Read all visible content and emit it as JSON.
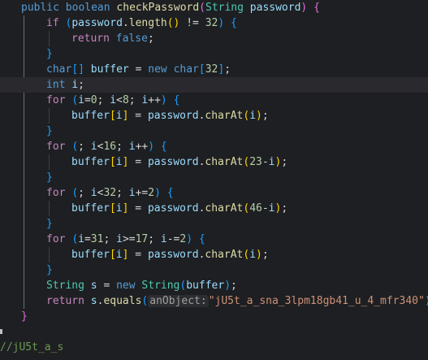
{
  "editor": {
    "lines": [
      [
        {
          "t": "public",
          "c": "kw"
        },
        {
          "t": " ",
          "c": "pun"
        },
        {
          "t": "boolean",
          "c": "kw"
        },
        {
          "t": " ",
          "c": "pun"
        },
        {
          "t": "checkPassword",
          "c": "fn"
        },
        {
          "t": "(",
          "c": "brace"
        },
        {
          "t": "String",
          "c": "type"
        },
        {
          "t": " ",
          "c": "pun"
        },
        {
          "t": "password",
          "c": "var"
        },
        {
          "t": ")",
          "c": "brace"
        },
        {
          "t": " ",
          "c": "pun"
        },
        {
          "t": "{",
          "c": "brace"
        }
      ],
      [
        {
          "t": "if",
          "c": "ctl"
        },
        {
          "t": " ",
          "c": "pun"
        },
        {
          "t": "(",
          "c": "brace2"
        },
        {
          "t": "password",
          "c": "var"
        },
        {
          "t": ".",
          "c": "pun"
        },
        {
          "t": "length",
          "c": "fn"
        },
        {
          "t": "()",
          "c": "brace3"
        },
        {
          "t": " != ",
          "c": "pun"
        },
        {
          "t": "32",
          "c": "num"
        },
        {
          "t": ")",
          "c": "brace2"
        },
        {
          "t": " ",
          "c": "pun"
        },
        {
          "t": "{",
          "c": "brace2"
        }
      ],
      [
        {
          "t": "return",
          "c": "ctl"
        },
        {
          "t": " ",
          "c": "pun"
        },
        {
          "t": "false",
          "c": "kw"
        },
        {
          "t": ";",
          "c": "pun"
        }
      ],
      [
        {
          "t": "}",
          "c": "brace2"
        }
      ],
      [
        {
          "t": "char",
          "c": "kw"
        },
        {
          "t": "[]",
          "c": "brace2"
        },
        {
          "t": " ",
          "c": "pun"
        },
        {
          "t": "buffer",
          "c": "var"
        },
        {
          "t": " = ",
          "c": "pun"
        },
        {
          "t": "new",
          "c": "kw"
        },
        {
          "t": " ",
          "c": "pun"
        },
        {
          "t": "char",
          "c": "kw"
        },
        {
          "t": "[",
          "c": "brace2"
        },
        {
          "t": "32",
          "c": "num"
        },
        {
          "t": "]",
          "c": "brace2"
        },
        {
          "t": ";",
          "c": "pun"
        }
      ],
      [
        {
          "t": "int",
          "c": "kw"
        },
        {
          "t": " ",
          "c": "pun"
        },
        {
          "t": "i",
          "c": "var"
        },
        {
          "t": ";",
          "c": "pun"
        }
      ],
      [
        {
          "t": "for",
          "c": "ctl"
        },
        {
          "t": " ",
          "c": "pun"
        },
        {
          "t": "(",
          "c": "brace2"
        },
        {
          "t": "i",
          "c": "var"
        },
        {
          "t": "=",
          "c": "pun"
        },
        {
          "t": "0",
          "c": "num"
        },
        {
          "t": "; ",
          "c": "pun"
        },
        {
          "t": "i",
          "c": "var"
        },
        {
          "t": "<",
          "c": "pun"
        },
        {
          "t": "8",
          "c": "num"
        },
        {
          "t": "; ",
          "c": "pun"
        },
        {
          "t": "i",
          "c": "var"
        },
        {
          "t": "++",
          "c": "pun"
        },
        {
          "t": ")",
          "c": "brace2"
        },
        {
          "t": " ",
          "c": "pun"
        },
        {
          "t": "{",
          "c": "brace2"
        }
      ],
      [
        {
          "t": "buffer",
          "c": "var"
        },
        {
          "t": "[",
          "c": "brace3"
        },
        {
          "t": "i",
          "c": "var"
        },
        {
          "t": "]",
          "c": "brace3"
        },
        {
          "t": " = ",
          "c": "pun"
        },
        {
          "t": "password",
          "c": "var"
        },
        {
          "t": ".",
          "c": "pun"
        },
        {
          "t": "charAt",
          "c": "fn"
        },
        {
          "t": "(",
          "c": "brace3"
        },
        {
          "t": "i",
          "c": "var"
        },
        {
          "t": ")",
          "c": "brace3"
        },
        {
          "t": ";",
          "c": "pun"
        }
      ],
      [
        {
          "t": "}",
          "c": "brace2"
        }
      ],
      [
        {
          "t": "for",
          "c": "ctl"
        },
        {
          "t": " ",
          "c": "pun"
        },
        {
          "t": "(",
          "c": "brace2"
        },
        {
          "t": "; ",
          "c": "pun"
        },
        {
          "t": "i",
          "c": "var"
        },
        {
          "t": "<",
          "c": "pun"
        },
        {
          "t": "16",
          "c": "num"
        },
        {
          "t": "; ",
          "c": "pun"
        },
        {
          "t": "i",
          "c": "var"
        },
        {
          "t": "++",
          "c": "pun"
        },
        {
          "t": ")",
          "c": "brace2"
        },
        {
          "t": " ",
          "c": "pun"
        },
        {
          "t": "{",
          "c": "brace2"
        }
      ],
      [
        {
          "t": "buffer",
          "c": "var"
        },
        {
          "t": "[",
          "c": "brace3"
        },
        {
          "t": "i",
          "c": "var"
        },
        {
          "t": "]",
          "c": "brace3"
        },
        {
          "t": " = ",
          "c": "pun"
        },
        {
          "t": "password",
          "c": "var"
        },
        {
          "t": ".",
          "c": "pun"
        },
        {
          "t": "charAt",
          "c": "fn"
        },
        {
          "t": "(",
          "c": "brace3"
        },
        {
          "t": "23",
          "c": "num"
        },
        {
          "t": "-",
          "c": "pun"
        },
        {
          "t": "i",
          "c": "var"
        },
        {
          "t": ")",
          "c": "brace3"
        },
        {
          "t": ";",
          "c": "pun"
        }
      ],
      [
        {
          "t": "}",
          "c": "brace2"
        }
      ],
      [
        {
          "t": "for",
          "c": "ctl"
        },
        {
          "t": " ",
          "c": "pun"
        },
        {
          "t": "(",
          "c": "brace2"
        },
        {
          "t": "; ",
          "c": "pun"
        },
        {
          "t": "i",
          "c": "var"
        },
        {
          "t": "<",
          "c": "pun"
        },
        {
          "t": "32",
          "c": "num"
        },
        {
          "t": "; ",
          "c": "pun"
        },
        {
          "t": "i",
          "c": "var"
        },
        {
          "t": "+=",
          "c": "pun"
        },
        {
          "t": "2",
          "c": "num"
        },
        {
          "t": ")",
          "c": "brace2"
        },
        {
          "t": " ",
          "c": "pun"
        },
        {
          "t": "{",
          "c": "brace2"
        }
      ],
      [
        {
          "t": "buffer",
          "c": "var"
        },
        {
          "t": "[",
          "c": "brace3"
        },
        {
          "t": "i",
          "c": "var"
        },
        {
          "t": "]",
          "c": "brace3"
        },
        {
          "t": " = ",
          "c": "pun"
        },
        {
          "t": "password",
          "c": "var"
        },
        {
          "t": ".",
          "c": "pun"
        },
        {
          "t": "charAt",
          "c": "fn"
        },
        {
          "t": "(",
          "c": "brace3"
        },
        {
          "t": "46",
          "c": "num"
        },
        {
          "t": "-",
          "c": "pun"
        },
        {
          "t": "i",
          "c": "var"
        },
        {
          "t": ")",
          "c": "brace3"
        },
        {
          "t": ";",
          "c": "pun"
        }
      ],
      [
        {
          "t": "}",
          "c": "brace2"
        }
      ],
      [
        {
          "t": "for",
          "c": "ctl"
        },
        {
          "t": " ",
          "c": "pun"
        },
        {
          "t": "(",
          "c": "brace2"
        },
        {
          "t": "i",
          "c": "var"
        },
        {
          "t": "=",
          "c": "pun"
        },
        {
          "t": "31",
          "c": "num"
        },
        {
          "t": "; ",
          "c": "pun"
        },
        {
          "t": "i",
          "c": "var"
        },
        {
          "t": ">=",
          "c": "pun"
        },
        {
          "t": "17",
          "c": "num"
        },
        {
          "t": "; ",
          "c": "pun"
        },
        {
          "t": "i",
          "c": "var"
        },
        {
          "t": "-=",
          "c": "pun"
        },
        {
          "t": "2",
          "c": "num"
        },
        {
          "t": ")",
          "c": "brace2"
        },
        {
          "t": " ",
          "c": "pun"
        },
        {
          "t": "{",
          "c": "brace2"
        }
      ],
      [
        {
          "t": "buffer",
          "c": "var"
        },
        {
          "t": "[",
          "c": "brace3"
        },
        {
          "t": "i",
          "c": "var"
        },
        {
          "t": "]",
          "c": "brace3"
        },
        {
          "t": " = ",
          "c": "pun"
        },
        {
          "t": "password",
          "c": "var"
        },
        {
          "t": ".",
          "c": "pun"
        },
        {
          "t": "charAt",
          "c": "fn"
        },
        {
          "t": "(",
          "c": "brace3"
        },
        {
          "t": "i",
          "c": "var"
        },
        {
          "t": ")",
          "c": "brace3"
        },
        {
          "t": ";",
          "c": "pun"
        }
      ],
      [
        {
          "t": "}",
          "c": "brace2"
        }
      ],
      [
        {
          "t": "String",
          "c": "type"
        },
        {
          "t": " ",
          "c": "pun"
        },
        {
          "t": "s",
          "c": "var"
        },
        {
          "t": " = ",
          "c": "pun"
        },
        {
          "t": "new",
          "c": "kw"
        },
        {
          "t": " ",
          "c": "pun"
        },
        {
          "t": "String",
          "c": "type"
        },
        {
          "t": "(",
          "c": "brace2"
        },
        {
          "t": "buffer",
          "c": "var"
        },
        {
          "t": ")",
          "c": "brace2"
        },
        {
          "t": ";",
          "c": "pun"
        }
      ],
      [
        {
          "t": "return",
          "c": "ctl"
        },
        {
          "t": " ",
          "c": "pun"
        },
        {
          "t": "s",
          "c": "var"
        },
        {
          "t": ".",
          "c": "pun"
        },
        {
          "t": "equals",
          "c": "fn"
        },
        {
          "t": "(",
          "c": "brace2"
        },
        {
          "t": "anObject:",
          "c": "hint"
        },
        {
          "t": "\"jU5t_a_sna_3lpm18gb41_u_4_mfr340\"",
          "c": "str"
        },
        {
          "t": ")",
          "c": "brace2"
        },
        {
          "t": ";",
          "c": "pun"
        }
      ],
      [
        {
          "t": "}",
          "c": "brace"
        }
      ],
      [],
      [
        {
          "t": "//jU5t_a_s",
          "c": "cmt"
        }
      ]
    ],
    "lightbulb_icon": "lightbulb-icon",
    "colors": {
      "background": "#1e1f22",
      "keyword": "#569cd6",
      "control": "#c586c0",
      "type": "#4ec9b0",
      "function": "#dcdcaa",
      "variable": "#9cdcfe",
      "number": "#b5cea8",
      "string": "#ce9178",
      "comment": "#6a9955",
      "bulb": "#ffcc00"
    }
  }
}
